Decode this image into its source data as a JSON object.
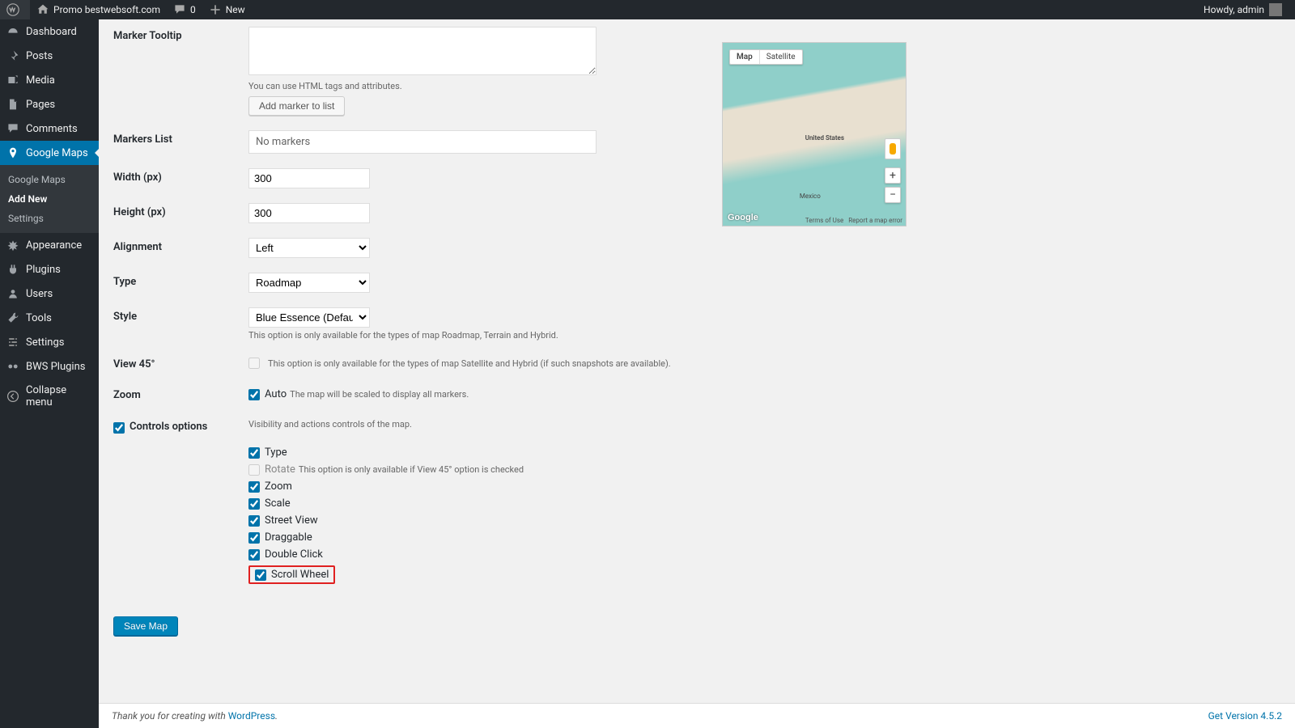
{
  "topbar": {
    "site_name": "Promo bestwebsoft.com",
    "comments_count": "0",
    "new_label": "New",
    "howdy": "Howdy, admin"
  },
  "sidebar": {
    "dashboard": "Dashboard",
    "posts": "Posts",
    "media": "Media",
    "pages": "Pages",
    "comments": "Comments",
    "google_maps": "Google Maps",
    "sub_google_maps": "Google Maps",
    "sub_add_new": "Add New",
    "sub_settings": "Settings",
    "appearance": "Appearance",
    "plugins": "Plugins",
    "users": "Users",
    "tools": "Tools",
    "settings": "Settings",
    "bws_plugins": "BWS Plugins",
    "collapse": "Collapse menu"
  },
  "form": {
    "marker_tooltip_label": "Marker Tooltip",
    "tooltip_hint": "You can use HTML tags and attributes.",
    "add_marker_btn": "Add marker to list",
    "markers_list_label": "Markers List",
    "markers_list_value": "No markers",
    "width_label": "Width (px)",
    "width_value": "300",
    "height_label": "Height (px)",
    "height_value": "300",
    "alignment_label": "Alignment",
    "alignment_value": "Left",
    "type_label": "Type",
    "type_value": "Roadmap",
    "style_label": "Style",
    "style_value": "Blue Essence (Default)",
    "style_hint": "This option is only available for the types of map Roadmap, Terrain and Hybrid.",
    "view45_label": "View 45°",
    "view45_hint": "This option is only available for the types of map Satellite and Hybrid (if such snapshots are available).",
    "zoom_label": "Zoom",
    "zoom_auto": "Auto",
    "zoom_hint": "The map will be scaled to display all markers.",
    "controls_label": "Controls options",
    "controls_hint": "Visibility and actions controls of the map.",
    "ctrl_type": "Type",
    "ctrl_rotate": "Rotate",
    "ctrl_rotate_hint": "This option is only available if View 45° option is checked",
    "ctrl_zoom": "Zoom",
    "ctrl_scale": "Scale",
    "ctrl_street_view": "Street View",
    "ctrl_draggable": "Draggable",
    "ctrl_double_click": "Double Click",
    "ctrl_scroll_wheel": "Scroll Wheel",
    "save_btn": "Save Map"
  },
  "map": {
    "map_btn": "Map",
    "satellite_btn": "Satellite",
    "us_label": "United States",
    "mexico_label": "Mexico",
    "terms": "Terms of Use",
    "report": "Report a map error",
    "logo": "Google"
  },
  "footer": {
    "thanks": "Thank you for creating with ",
    "wp": "WordPress",
    "version": "Get Version 4.5.2"
  }
}
